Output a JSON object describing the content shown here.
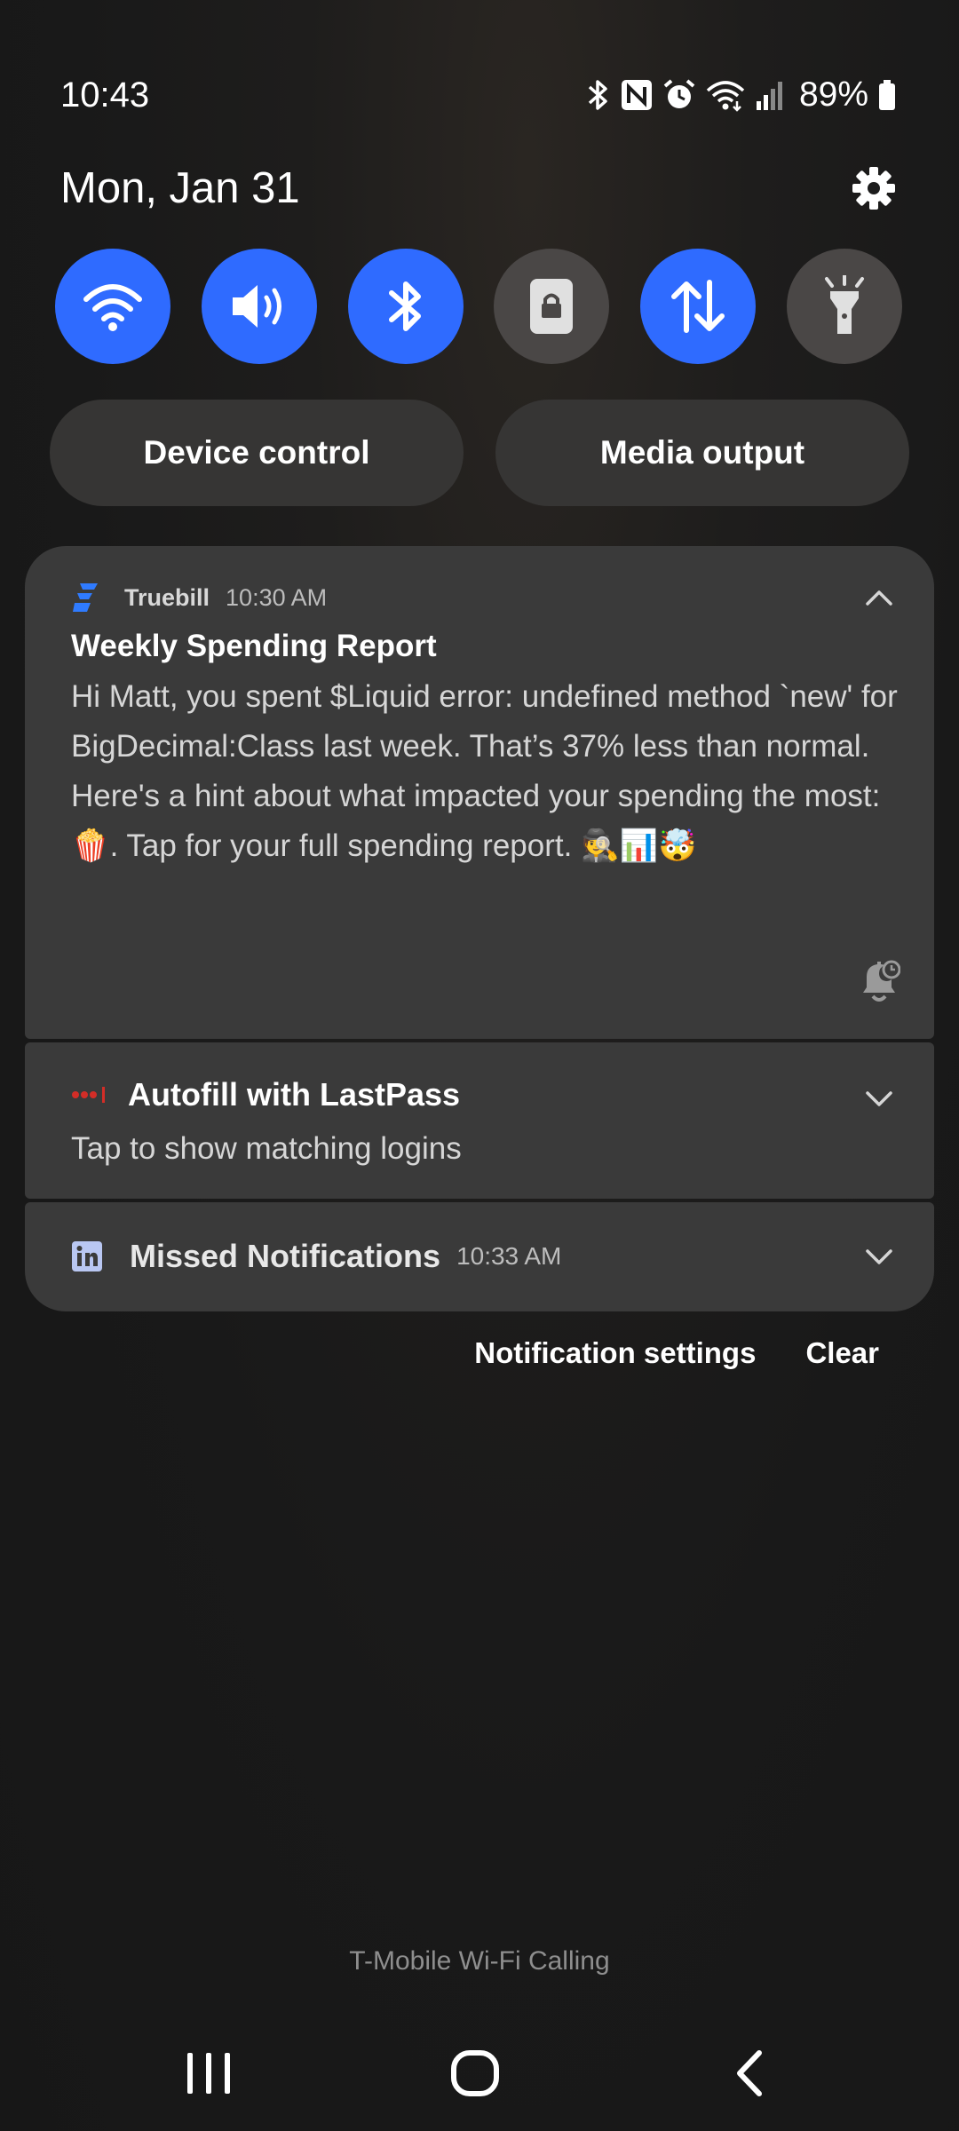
{
  "status_bar": {
    "time": "10:43",
    "battery": "89%",
    "icons": [
      "bluetooth-icon",
      "nfc-icon",
      "alarm-icon",
      "wifi-calling-icon",
      "signal-icon",
      "battery-icon"
    ]
  },
  "header": {
    "date": "Mon, Jan 31",
    "settings_icon": "gear-icon"
  },
  "quick_settings": [
    {
      "name": "wifi",
      "icon": "wifi-icon",
      "active": true
    },
    {
      "name": "sound",
      "icon": "speaker-icon",
      "active": true
    },
    {
      "name": "bluetooth",
      "icon": "bluetooth-icon",
      "active": true
    },
    {
      "name": "portrait-lock",
      "icon": "lock-icon",
      "active": false
    },
    {
      "name": "mobile-data",
      "icon": "data-arrows-icon",
      "active": true
    },
    {
      "name": "flashlight",
      "icon": "flashlight-icon",
      "active": false
    }
  ],
  "buttons": {
    "device_control": "Device control",
    "media_output": "Media output"
  },
  "notifications": {
    "truebill": {
      "app": "Truebill",
      "time": "10:30 AM",
      "title": "Weekly Spending Report",
      "body": "Hi Matt, you spent $Liquid error: undefined method `new' for BigDecimal:Class last week. That’s 37% less than normal. Here's a hint about what impacted your spending the most: 🍿. Tap for your full spending report. 🕵📊🤯"
    },
    "lastpass": {
      "title": "Autofill with LastPass",
      "subtitle": "Tap to show matching logins"
    },
    "linkedin": {
      "title": "Missed Notifications",
      "time": "10:33 AM"
    }
  },
  "actions": {
    "settings": "Notification settings",
    "clear": "Clear"
  },
  "carrier": "T-Mobile Wi-Fi Calling",
  "colors": {
    "accent": "#2f6bff",
    "inactive_tile": "#4a4746",
    "card": "#3a3a3a",
    "lastpass_red": "#d32d27",
    "linkedin_blue": "#b9c7f2"
  }
}
